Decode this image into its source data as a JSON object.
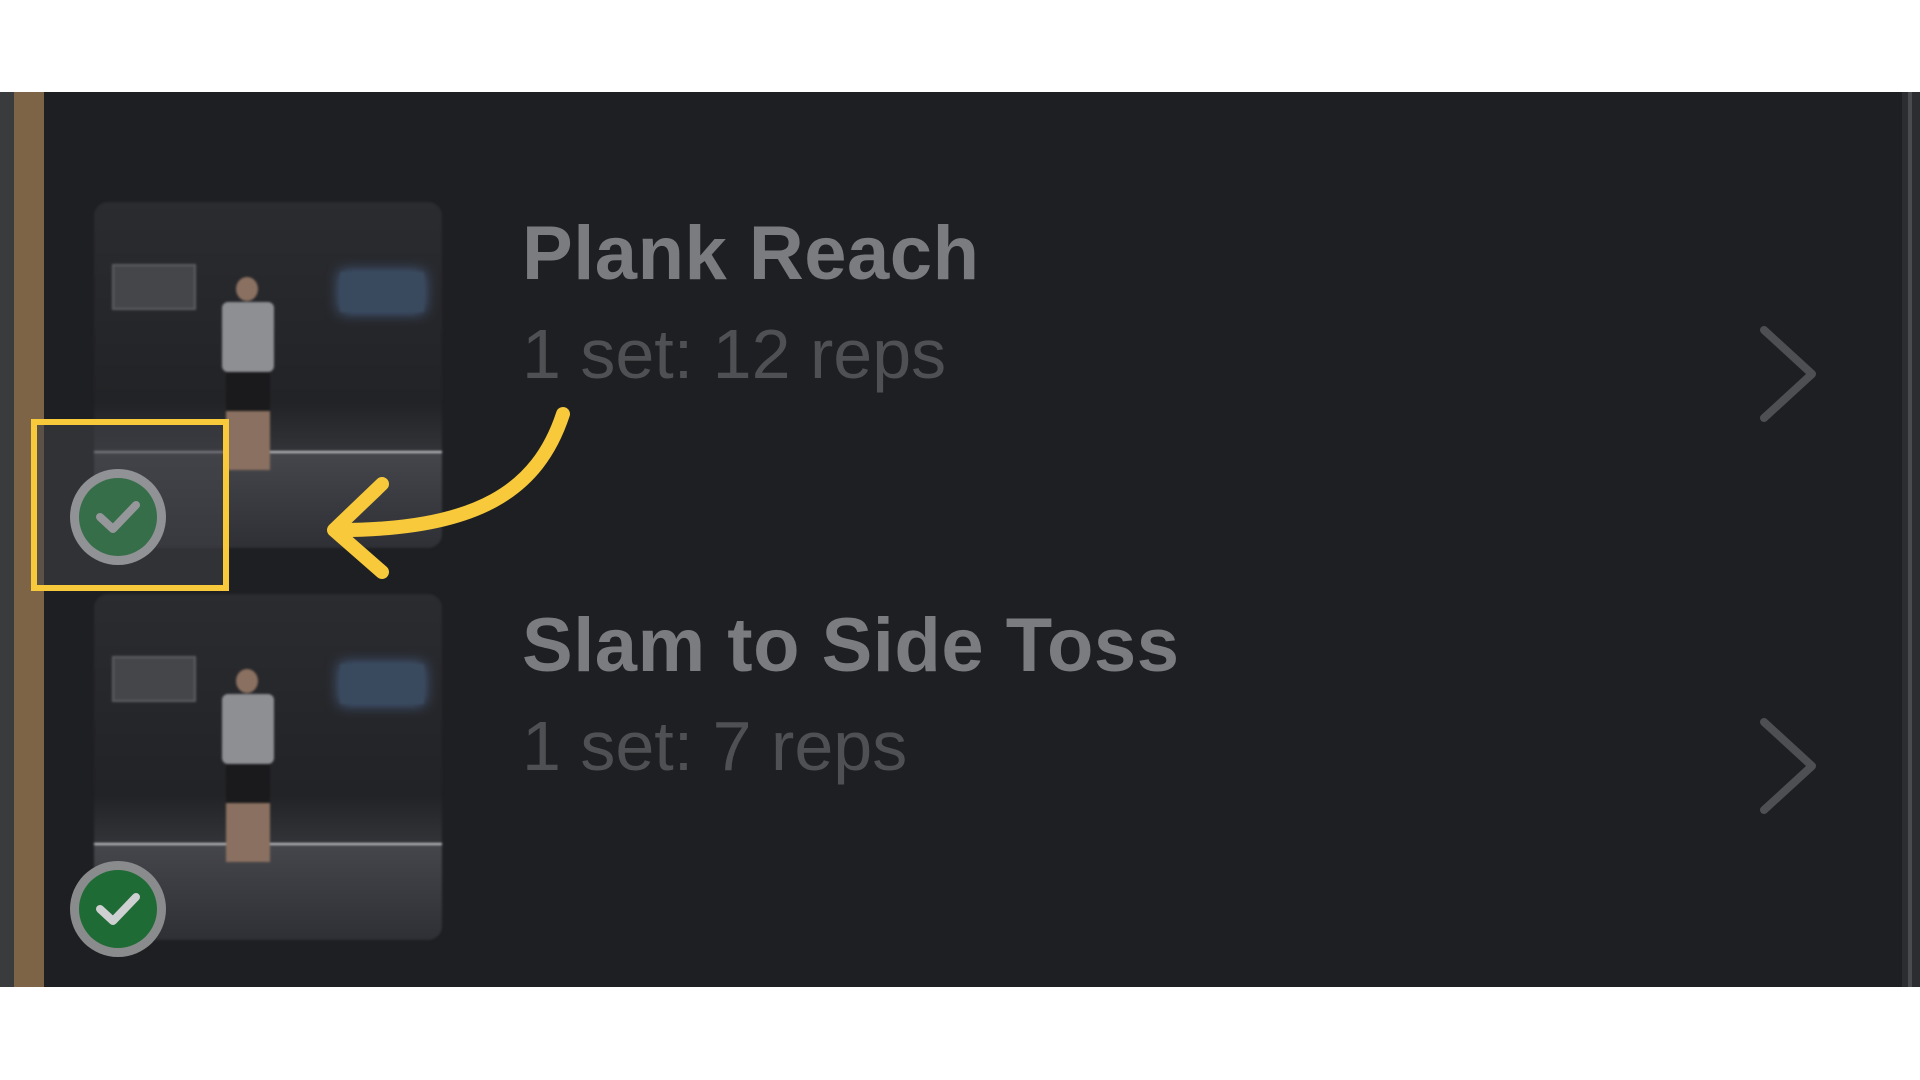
{
  "exercises": [
    {
      "title": "Plank Reach",
      "detail": "1 set: 12 reps",
      "completed": true
    },
    {
      "title": "Slam to Side Toss",
      "detail": "1 set: 7 reps",
      "completed": true
    }
  ],
  "colors": {
    "background": "#1d1f22",
    "highlight": "#f7c93b",
    "check_green": "#2ea44f"
  },
  "icons": [
    "check-circle-icon",
    "chevron-right-icon",
    "arrow-annotation-icon"
  ]
}
